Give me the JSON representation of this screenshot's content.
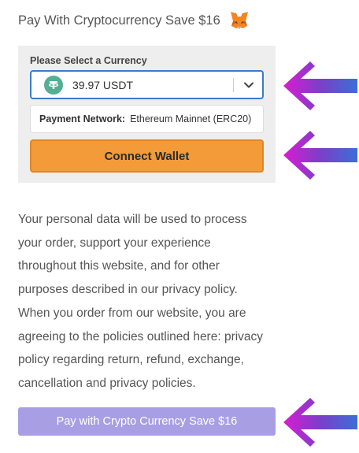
{
  "header": {
    "title": "Pay With Cryptocurrency Save $16",
    "logo_icon": "metamask-fox-icon"
  },
  "currency": {
    "label": "Please Select a Currency",
    "selected_value": "39.97 USDT",
    "selected_icon": "tether-icon",
    "tether_color": "#53ae94"
  },
  "network": {
    "label": "Payment Network:",
    "value": "Ethereum Mainnet (ERC20)"
  },
  "connect_button": {
    "label": "Connect Wallet",
    "color": "#f29b38"
  },
  "policy_lines": [
    "Your personal data will be used to process",
    "your order, support your experience",
    "throughout this website, and for other",
    "purposes described in our privacy policy.",
    "When you order from our website, you are",
    "agreeing to the policies outlined here: privacy",
    "policy regarding return, refund, exchange,",
    "cancellation and privacy policies."
  ],
  "pay_button": {
    "label": "Pay with Crypto Currency Save $16",
    "color": "#a89ee4"
  },
  "annotation_arrows": {
    "count": 3,
    "gradient": [
      "#d91bd2",
      "#7b3fc9",
      "#3b6fd6"
    ]
  }
}
